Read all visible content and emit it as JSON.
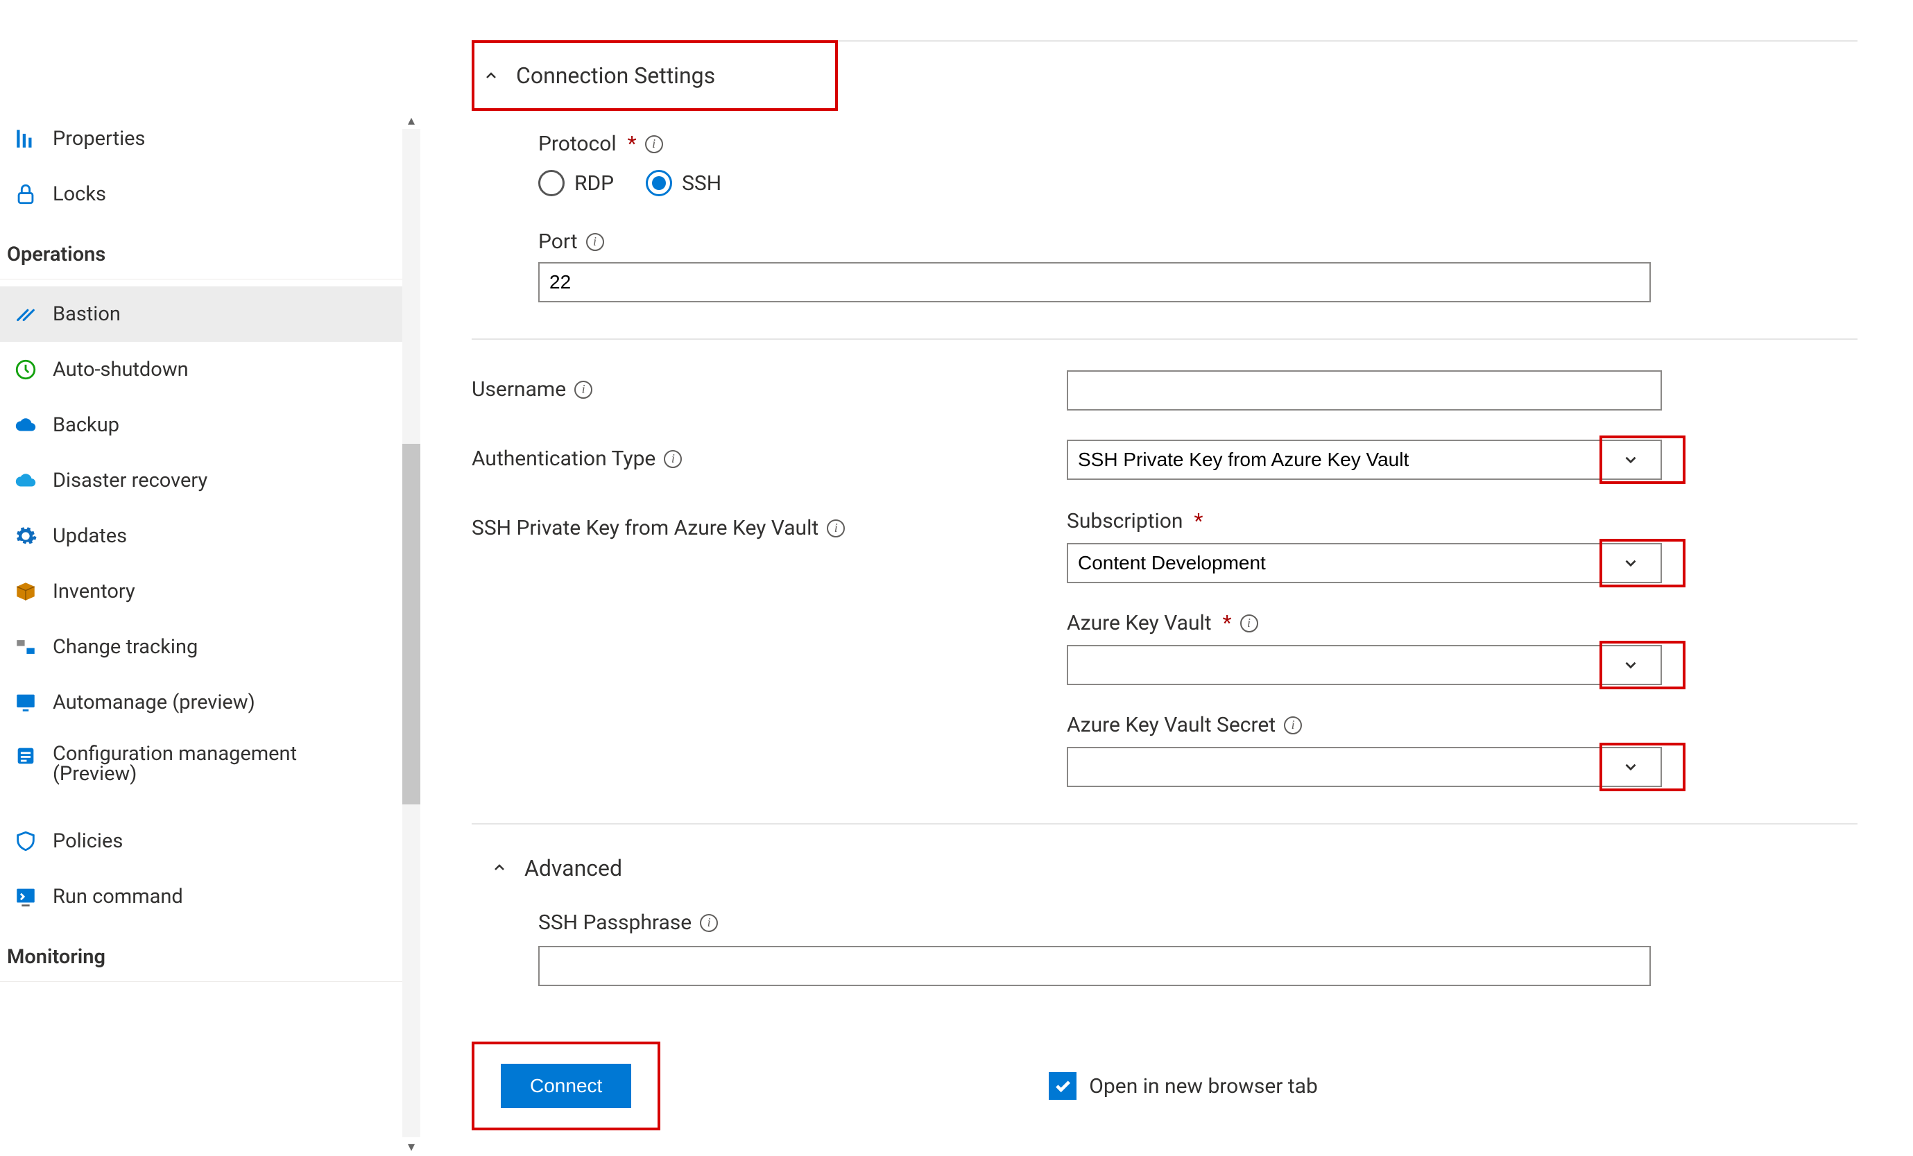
{
  "sidebar": {
    "items_top": [
      {
        "label": "Properties",
        "icon": "properties"
      },
      {
        "label": "Locks",
        "icon": "lock"
      }
    ],
    "section_operations": "Operations",
    "items_ops": [
      {
        "label": "Bastion",
        "icon": "bastion",
        "active": true
      },
      {
        "label": "Auto-shutdown",
        "icon": "clock"
      },
      {
        "label": "Backup",
        "icon": "cloud"
      },
      {
        "label": "Disaster recovery",
        "icon": "cloud-blue"
      },
      {
        "label": "Updates",
        "icon": "gear-blue"
      },
      {
        "label": "Inventory",
        "icon": "box"
      },
      {
        "label": "Change tracking",
        "icon": "tracking"
      },
      {
        "label": "Automanage (preview)",
        "icon": "monitor"
      },
      {
        "label": "Configuration management (Preview)",
        "icon": "list"
      },
      {
        "label": "Policies",
        "icon": "policy"
      },
      {
        "label": "Run command",
        "icon": "terminal"
      }
    ],
    "section_monitoring": "Monitoring"
  },
  "main": {
    "connection_settings_title": "Connection Settings",
    "protocol": {
      "label": "Protocol",
      "option_rdp": "RDP",
      "option_ssh": "SSH",
      "selected": "SSH"
    },
    "port": {
      "label": "Port",
      "value": "22"
    },
    "username": {
      "label": "Username",
      "value": ""
    },
    "auth_type": {
      "label": "Authentication Type",
      "value": "SSH Private Key from Azure Key Vault"
    },
    "ssh_kv_section_label": "SSH Private Key from Azure Key Vault",
    "subscription": {
      "label": "Subscription",
      "value": "Content Development"
    },
    "key_vault": {
      "label": "Azure Key Vault",
      "value": ""
    },
    "kv_secret": {
      "label": "Azure Key Vault Secret",
      "value": ""
    },
    "advanced_title": "Advanced",
    "ssh_passphrase": {
      "label": "SSH Passphrase",
      "value": ""
    },
    "connect_button": "Connect",
    "open_new_tab_label": "Open in new browser tab",
    "open_new_tab_checked": true
  }
}
